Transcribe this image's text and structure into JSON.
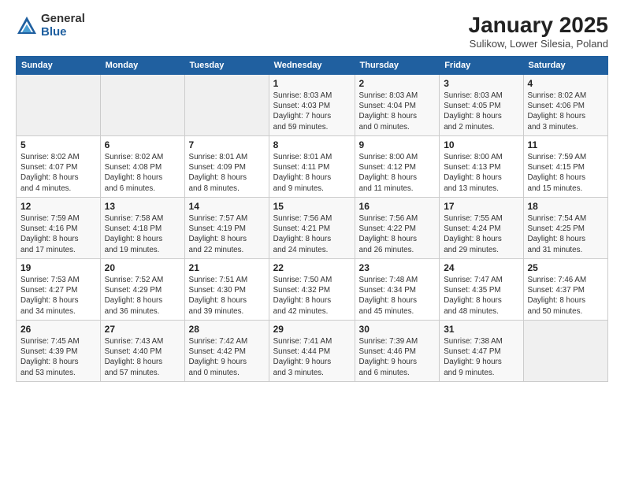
{
  "logo": {
    "general": "General",
    "blue": "Blue"
  },
  "title": {
    "month": "January 2025",
    "location": "Sulikow, Lower Silesia, Poland"
  },
  "headers": [
    "Sunday",
    "Monday",
    "Tuesday",
    "Wednesday",
    "Thursday",
    "Friday",
    "Saturday"
  ],
  "weeks": [
    [
      {
        "day": "",
        "info": ""
      },
      {
        "day": "",
        "info": ""
      },
      {
        "day": "",
        "info": ""
      },
      {
        "day": "1",
        "info": "Sunrise: 8:03 AM\nSunset: 4:03 PM\nDaylight: 7 hours\nand 59 minutes."
      },
      {
        "day": "2",
        "info": "Sunrise: 8:03 AM\nSunset: 4:04 PM\nDaylight: 8 hours\nand 0 minutes."
      },
      {
        "day": "3",
        "info": "Sunrise: 8:03 AM\nSunset: 4:05 PM\nDaylight: 8 hours\nand 2 minutes."
      },
      {
        "day": "4",
        "info": "Sunrise: 8:02 AM\nSunset: 4:06 PM\nDaylight: 8 hours\nand 3 minutes."
      }
    ],
    [
      {
        "day": "5",
        "info": "Sunrise: 8:02 AM\nSunset: 4:07 PM\nDaylight: 8 hours\nand 4 minutes."
      },
      {
        "day": "6",
        "info": "Sunrise: 8:02 AM\nSunset: 4:08 PM\nDaylight: 8 hours\nand 6 minutes."
      },
      {
        "day": "7",
        "info": "Sunrise: 8:01 AM\nSunset: 4:09 PM\nDaylight: 8 hours\nand 8 minutes."
      },
      {
        "day": "8",
        "info": "Sunrise: 8:01 AM\nSunset: 4:11 PM\nDaylight: 8 hours\nand 9 minutes."
      },
      {
        "day": "9",
        "info": "Sunrise: 8:00 AM\nSunset: 4:12 PM\nDaylight: 8 hours\nand 11 minutes."
      },
      {
        "day": "10",
        "info": "Sunrise: 8:00 AM\nSunset: 4:13 PM\nDaylight: 8 hours\nand 13 minutes."
      },
      {
        "day": "11",
        "info": "Sunrise: 7:59 AM\nSunset: 4:15 PM\nDaylight: 8 hours\nand 15 minutes."
      }
    ],
    [
      {
        "day": "12",
        "info": "Sunrise: 7:59 AM\nSunset: 4:16 PM\nDaylight: 8 hours\nand 17 minutes."
      },
      {
        "day": "13",
        "info": "Sunrise: 7:58 AM\nSunset: 4:18 PM\nDaylight: 8 hours\nand 19 minutes."
      },
      {
        "day": "14",
        "info": "Sunrise: 7:57 AM\nSunset: 4:19 PM\nDaylight: 8 hours\nand 22 minutes."
      },
      {
        "day": "15",
        "info": "Sunrise: 7:56 AM\nSunset: 4:21 PM\nDaylight: 8 hours\nand 24 minutes."
      },
      {
        "day": "16",
        "info": "Sunrise: 7:56 AM\nSunset: 4:22 PM\nDaylight: 8 hours\nand 26 minutes."
      },
      {
        "day": "17",
        "info": "Sunrise: 7:55 AM\nSunset: 4:24 PM\nDaylight: 8 hours\nand 29 minutes."
      },
      {
        "day": "18",
        "info": "Sunrise: 7:54 AM\nSunset: 4:25 PM\nDaylight: 8 hours\nand 31 minutes."
      }
    ],
    [
      {
        "day": "19",
        "info": "Sunrise: 7:53 AM\nSunset: 4:27 PM\nDaylight: 8 hours\nand 34 minutes."
      },
      {
        "day": "20",
        "info": "Sunrise: 7:52 AM\nSunset: 4:29 PM\nDaylight: 8 hours\nand 36 minutes."
      },
      {
        "day": "21",
        "info": "Sunrise: 7:51 AM\nSunset: 4:30 PM\nDaylight: 8 hours\nand 39 minutes."
      },
      {
        "day": "22",
        "info": "Sunrise: 7:50 AM\nSunset: 4:32 PM\nDaylight: 8 hours\nand 42 minutes."
      },
      {
        "day": "23",
        "info": "Sunrise: 7:48 AM\nSunset: 4:34 PM\nDaylight: 8 hours\nand 45 minutes."
      },
      {
        "day": "24",
        "info": "Sunrise: 7:47 AM\nSunset: 4:35 PM\nDaylight: 8 hours\nand 48 minutes."
      },
      {
        "day": "25",
        "info": "Sunrise: 7:46 AM\nSunset: 4:37 PM\nDaylight: 8 hours\nand 50 minutes."
      }
    ],
    [
      {
        "day": "26",
        "info": "Sunrise: 7:45 AM\nSunset: 4:39 PM\nDaylight: 8 hours\nand 53 minutes."
      },
      {
        "day": "27",
        "info": "Sunrise: 7:43 AM\nSunset: 4:40 PM\nDaylight: 8 hours\nand 57 minutes."
      },
      {
        "day": "28",
        "info": "Sunrise: 7:42 AM\nSunset: 4:42 PM\nDaylight: 9 hours\nand 0 minutes."
      },
      {
        "day": "29",
        "info": "Sunrise: 7:41 AM\nSunset: 4:44 PM\nDaylight: 9 hours\nand 3 minutes."
      },
      {
        "day": "30",
        "info": "Sunrise: 7:39 AM\nSunset: 4:46 PM\nDaylight: 9 hours\nand 6 minutes."
      },
      {
        "day": "31",
        "info": "Sunrise: 7:38 AM\nSunset: 4:47 PM\nDaylight: 9 hours\nand 9 minutes."
      },
      {
        "day": "",
        "info": ""
      }
    ]
  ]
}
